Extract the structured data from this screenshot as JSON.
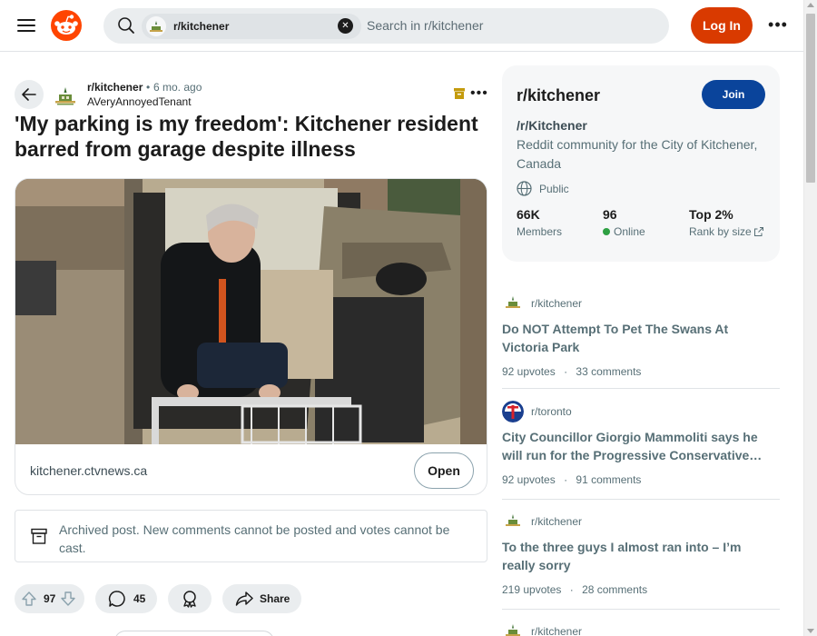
{
  "header": {
    "search_chip": "r/kitchener",
    "search_placeholder": "Search in r/kitchener",
    "login_label": "Log In",
    "more_label": "•••"
  },
  "post": {
    "subreddit": "r/kitchener",
    "time_dot": "•",
    "time": "6 mo. ago",
    "author": "AVeryAnnoyedTenant",
    "title": "'My parking is my freedom': Kitchener resident barred from garage despite illness",
    "link_domain": "kitchener.ctvnews.ca",
    "open_label": "Open",
    "archive_notice": "Archived post. New comments cannot be posted and votes cannot be cast.",
    "upvotes": "97",
    "comments": "45",
    "share_label": "Share",
    "more_label": "•••"
  },
  "community": {
    "name": "r/kitchener",
    "join_label": "Join",
    "title": "/r/Kitchener",
    "description": "Reddit community for the City of Kitchener, Canada",
    "visibility": "Public",
    "members_value": "66K",
    "members_label": "Members",
    "online_value": "96",
    "online_label": "Online",
    "rank_value": "Top 2%",
    "rank_label": "Rank by size"
  },
  "related": [
    {
      "subreddit": "r/kitchener",
      "title": "Do NOT Attempt To Pet The Swans At Victoria Park",
      "upvotes": "92 upvotes",
      "sep": "·",
      "comments": "33 comments"
    },
    {
      "subreddit": "r/toronto",
      "title": "City Councillor Giorgio Mammoliti says he will run for the Progressive Conservative…",
      "upvotes": "92 upvotes",
      "sep": "·",
      "comments": "91 comments"
    },
    {
      "subreddit": "r/kitchener",
      "title": "To the three guys I almost ran into – I’m really sorry",
      "upvotes": "219 upvotes",
      "sep": "·",
      "comments": "28 comments"
    },
    {
      "subreddit": "r/kitchener"
    }
  ],
  "colors": {
    "brand_orange": "#ff4500",
    "login_bg": "#d93a00",
    "join_bg": "#0a449b",
    "online_green": "#2ea043"
  },
  "icons": [
    "menu-icon",
    "reddit-logo",
    "search-icon",
    "close-icon",
    "back-arrow-icon",
    "archive-icon",
    "upvote-icon",
    "downvote-icon",
    "comment-icon",
    "award-icon",
    "share-icon",
    "globe-icon",
    "external-link-icon"
  ]
}
